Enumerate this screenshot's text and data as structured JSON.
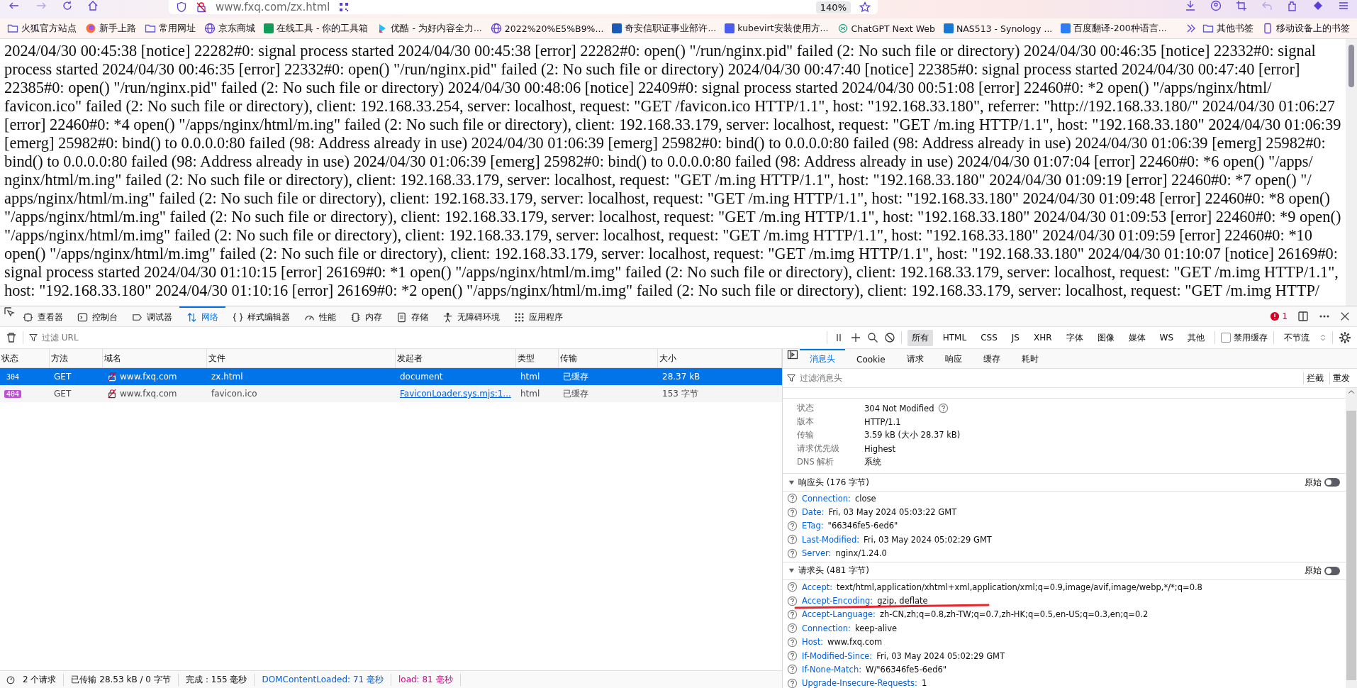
{
  "browser": {
    "url": "www.fxq.com/zx.html",
    "zoom": "140%"
  },
  "bookmarks": [
    {
      "label": "火狐官方站点"
    },
    {
      "label": "新手上路"
    },
    {
      "label": "常用网址"
    },
    {
      "label": "京东商城"
    },
    {
      "label": "在线工具 - 你的工具箱",
      "color": "#109d58"
    },
    {
      "label": "优酷 - 为好内容全力..."
    },
    {
      "label": "2022%20%E5%B9%..."
    },
    {
      "label": "奇安信职证事业部许...",
      "color": "#1a5bb8"
    },
    {
      "label": "kubevirt安装使用方...",
      "color": "#4a5cf0"
    },
    {
      "label": "ChatGPT Next Web"
    },
    {
      "label": "NAS513 - Synology ...",
      "color": "#1778d6"
    },
    {
      "label": "百度翻译-200种语言...",
      "color": "#2e7cf6"
    }
  ],
  "bookmarks_right": [
    {
      "label": "其他书签"
    },
    {
      "label": "移动设备上的书签"
    }
  ],
  "page": {
    "log": "2024/04/30 00:45:38 [notice] 22282#0: signal process started 2024/04/30 00:45:38 [error] 22282#0: open() \"/run/nginx.pid\" failed (2: No such file or directory) 2024/04/30 00:46:35 [notice] 22332#0: signal process started 2024/04/30 00:46:35 [error] 22332#0: open() \"/run/nginx.pid\" failed (2: No such file or directory) 2024/04/30 00:47:40 [notice] 22385#0: signal process started 2024/04/30 00:47:40 [error] 22385#0: open() \"/run/nginx.pid\" failed (2: No such file or directory) 2024/04/30 00:48:06 [notice] 22409#0: signal process started 2024/04/30 00:51:08 [error] 22460#0: *2 open() \"/apps/nginx/html/favicon.ico\" failed (2: No such file or directory), client: 192.168.33.254, server: localhost, request: \"GET /favicon.ico HTTP/1.1\", host: \"192.168.33.180\", referrer: \"http://192.168.33.180/\" 2024/04/30 01:06:27 [error] 22460#0: *4 open() \"/apps/nginx/html/m.ing\" failed (2: No such file or directory), client: 192.168.33.179, server: localhost, request: \"GET /m.ing HTTP/1.1\", host: \"192.168.33.180\" 2024/04/30 01:06:39 [emerg] 25982#0: bind() to 0.0.0.0:80 failed (98: Address already in use) 2024/04/30 01:06:39 [emerg] 25982#0: bind() to 0.0.0.0:80 failed (98: Address already in use) 2024/04/30 01:06:39 [emerg] 25982#0: bind() to 0.0.0.0:80 failed (98: Address already in use) 2024/04/30 01:06:39 [emerg] 25982#0: bind() to 0.0.0.0:80 failed (98: Address already in use) 2024/04/30 01:07:04 [error] 22460#0: *6 open() \"/apps/nginx/html/m.ing\" failed (2: No such file or directory), client: 192.168.33.179, server: localhost, request: \"GET /m.ing HTTP/1.1\", host: \"192.168.33.180\" 2024/04/30 01:09:19 [error] 22460#0: *7 open() \"/apps/nginx/html/m.ing\" failed (2: No such file or directory), client: 192.168.33.179, server: localhost, request: \"GET /m.ing HTTP/1.1\", host: \"192.168.33.180\" 2024/04/30 01:09:48 [error] 22460#0: *8 open() \"/apps/nginx/html/m.ing\" failed (2: No such file or directory), client: 192.168.33.179, server: localhost, request: \"GET /m.ing HTTP/1.1\", host: \"192.168.33.180\" 2024/04/30 01:09:53 [error] 22460#0: *9 open() \"/apps/nginx/html/m.img\" failed (2: No such file or directory), client: 192.168.33.179, server: localhost, request: \"GET /m.img HTTP/1.1\", host: \"192.168.33.180\" 2024/04/30 01:09:59 [error] 22460#0: *10 open() \"/apps/nginx/html/m.img\" failed (2: No such file or directory), client: 192.168.33.179, server: localhost, request: \"GET /m.img HTTP/1.1\", host: \"192.168.33.180\" 2024/04/30 01:10:07 [notice] 26169#0: signal process started 2024/04/30 01:10:15 [error] 26169#0: *1 open() \"/apps/nginx/html/m.img\" failed (2: No such file or directory), client: 192.168.33.179, server: localhost, request: \"GET /m.img HTTP/1.1\", host: \"192.168.33.180\" 2024/04/30 01:10:16 [error] 26169#0: *2 open() \"/apps/nginx/html/m.img\" failed (2: No such file or directory), client: 192.168.33.179, server: localhost, request: \"GET /m.img HTTP/"
  },
  "devtools": {
    "tabs": [
      {
        "label": "查看器",
        "selected": false
      },
      {
        "label": "控制台",
        "selected": false
      },
      {
        "label": "调试器",
        "selected": false
      },
      {
        "label": "网络",
        "selected": true
      },
      {
        "label": "样式编辑器",
        "selected": false
      },
      {
        "label": "性能",
        "selected": false
      },
      {
        "label": "内存",
        "selected": false
      },
      {
        "label": "存储",
        "selected": false
      },
      {
        "label": "无障碍环境",
        "selected": false
      },
      {
        "label": "应用程序",
        "selected": false
      }
    ],
    "error_count": "1",
    "filter_placeholder": "过滤 URL",
    "type_filters": [
      {
        "label": "所有",
        "selected": true
      },
      {
        "label": "HTML",
        "selected": false
      },
      {
        "label": "CSS",
        "selected": false
      },
      {
        "label": "JS",
        "selected": false
      },
      {
        "label": "XHR",
        "selected": false
      },
      {
        "label": "字体",
        "selected": false
      },
      {
        "label": "图像",
        "selected": false
      },
      {
        "label": "媒体",
        "selected": false
      },
      {
        "label": "WS",
        "selected": false
      },
      {
        "label": "其他",
        "selected": false
      }
    ],
    "disable_cache": {
      "label": "禁用缓存",
      "checked": false
    },
    "throttle": "不节流",
    "requests": {
      "columns": [
        "状态",
        "方法",
        "域名",
        "文件",
        "发起者",
        "类型",
        "传输",
        "大小"
      ],
      "rows": [
        {
          "status": "304",
          "color": "#0074e8",
          "method": "GET",
          "domain": "www.fxq.com",
          "file": "zx.html",
          "initiator": "document",
          "initiator_link": false,
          "type": "html",
          "transferred": "已缓存",
          "size": "28.37 kB",
          "selected": true
        },
        {
          "status": "404",
          "color": "#c14ed7",
          "method": "GET",
          "domain": "www.fxq.com",
          "file": "favicon.ico",
          "initiator": "FaviconLoader.sys.mjs:1...",
          "initiator_link": true,
          "type": "html",
          "transferred": "已缓存",
          "size": "153 字节",
          "selected": false
        }
      ]
    },
    "status_bar": [
      {
        "text": "2 个请求",
        "kind": "plain"
      },
      {
        "text": "已传输 28.53 kB / 0 字节",
        "kind": "plain"
      },
      {
        "text": "完成：155 毫秒",
        "kind": "plain"
      },
      {
        "text": "DOMContentLoaded: 71 毫秒",
        "kind": "dom"
      },
      {
        "text": "load: 81 毫秒",
        "kind": "load"
      }
    ],
    "details": {
      "tabs": [
        {
          "label": "消息头",
          "selected": true
        },
        {
          "label": "Cookie",
          "selected": false
        },
        {
          "label": "请求",
          "selected": false
        },
        {
          "label": "响应",
          "selected": false
        },
        {
          "label": "缓存",
          "selected": false
        },
        {
          "label": "耗时",
          "selected": false
        }
      ],
      "filter_placeholder": "过滤消息头",
      "actions": [
        "拦截",
        "重发"
      ],
      "summary": [
        {
          "label": "状态",
          "value": "304 Not Modified",
          "help": true
        },
        {
          "label": "版本",
          "value": "HTTP/1.1",
          "help": false
        },
        {
          "label": "传输",
          "value": "3.59 kB (大小 28.37 kB)",
          "help": false
        },
        {
          "label": "请求优先级",
          "value": "Highest",
          "help": false
        },
        {
          "label": "DNS 解析",
          "value": "系统",
          "help": false
        }
      ],
      "sections": [
        {
          "title": "响应头 (176 字节)",
          "expanded": true,
          "raw_label": "原始",
          "raw_on": false,
          "headers": [
            {
              "name": "Connection:",
              "value": "close",
              "annotated": false
            },
            {
              "name": "Date:",
              "value": "Fri, 03 May 2024 05:03:22 GMT",
              "annotated": false
            },
            {
              "name": "ETag:",
              "value": "\"66346fe5-6ed6\"",
              "annotated": false
            },
            {
              "name": "Last-Modified:",
              "value": "Fri, 03 May 2024 05:02:29 GMT",
              "annotated": false
            },
            {
              "name": "Server:",
              "value": "nginx/1.24.0",
              "annotated": false
            }
          ]
        },
        {
          "title": "请求头 (481 字节)",
          "expanded": true,
          "raw_label": "原始",
          "raw_on": false,
          "headers": [
            {
              "name": "Accept:",
              "value": "text/html,application/xhtml+xml,application/xml;q=0.9,image/avif,image/webp,*/*;q=0.8",
              "annotated": false
            },
            {
              "name": "Accept-Encoding:",
              "value": "gzip, deflate",
              "annotated": true
            },
            {
              "name": "Accept-Language:",
              "value": "zh-CN,zh;q=0.8,zh-TW;q=0.7,zh-HK;q=0.5,en-US;q=0.3,en;q=0.2",
              "annotated": false
            },
            {
              "name": "Connection:",
              "value": "keep-alive",
              "annotated": false
            },
            {
              "name": "Host:",
              "value": "www.fxq.com",
              "annotated": false
            },
            {
              "name": "If-Modified-Since:",
              "value": "Fri, 03 May 2024 05:02:29 GMT",
              "annotated": false
            },
            {
              "name": "If-None-Match:",
              "value": "W/\"66346fe5-6ed6\"",
              "annotated": false
            },
            {
              "name": "Upgrade-Insecure-Requests:",
              "value": "1",
              "annotated": false
            }
          ]
        }
      ]
    }
  }
}
